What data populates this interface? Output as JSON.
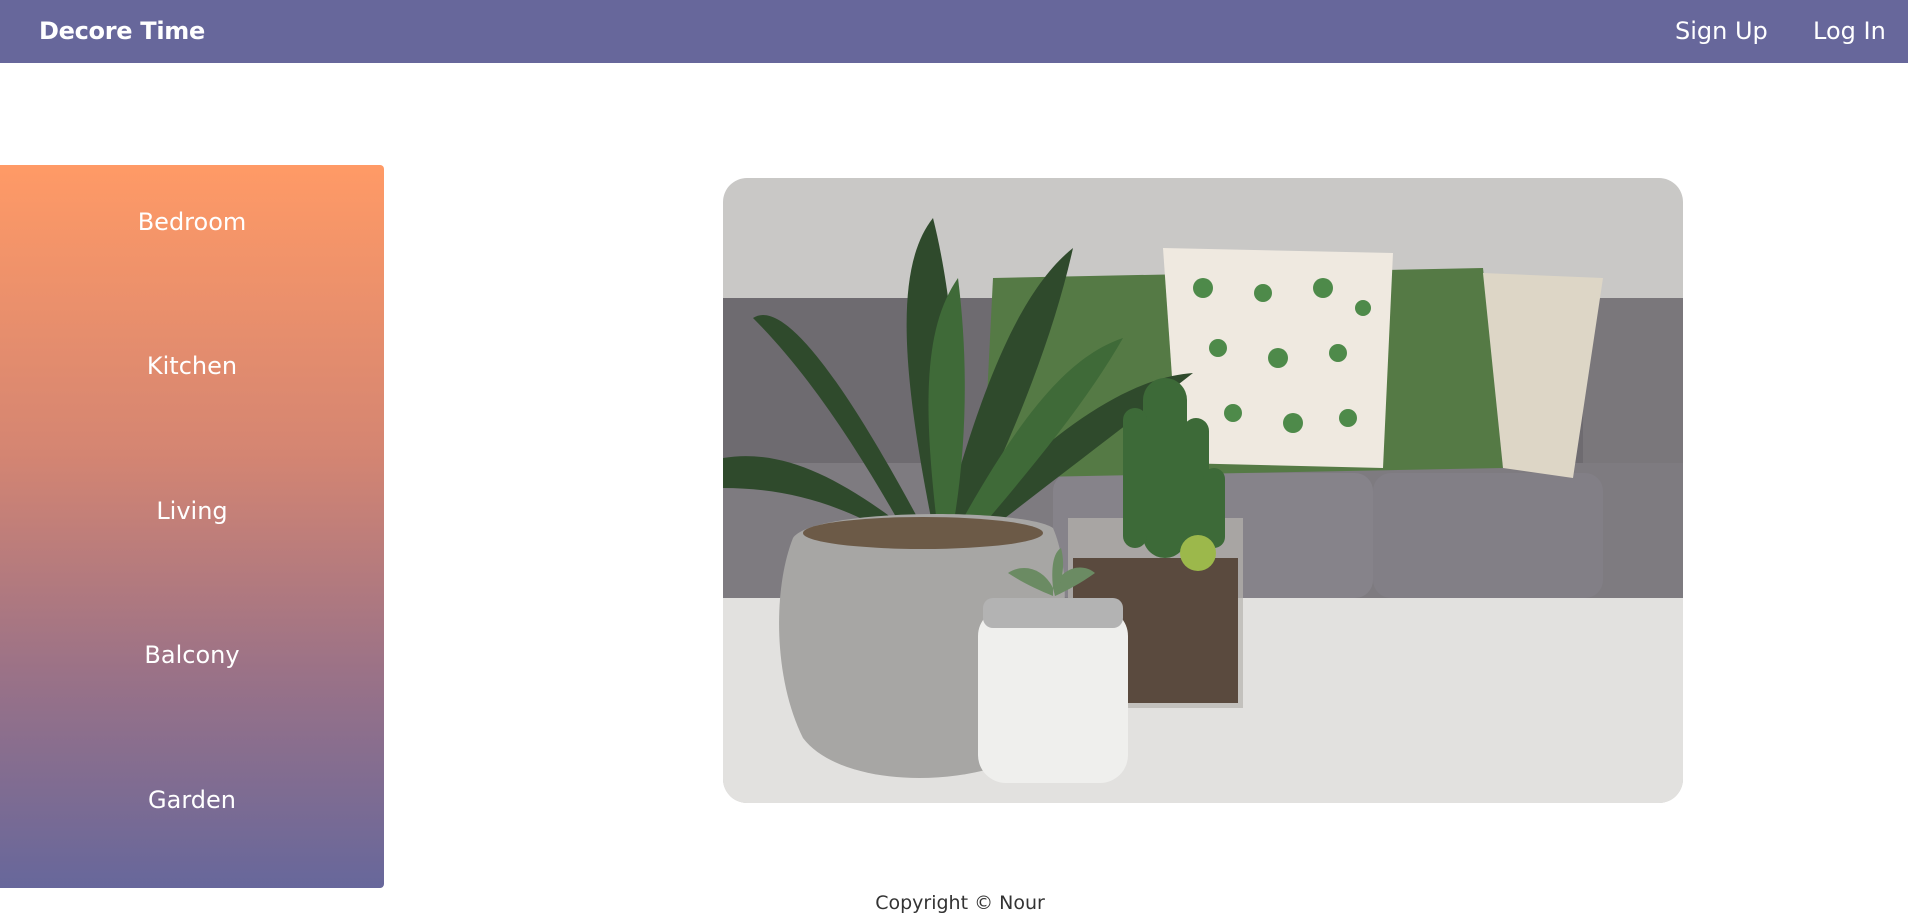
{
  "header": {
    "brand": "Decore Time",
    "nav": {
      "signup": "Sign Up",
      "login": "Log In"
    }
  },
  "sidebar": {
    "items": [
      {
        "label": "Bedroom"
      },
      {
        "label": "Kitchen"
      },
      {
        "label": "Living"
      },
      {
        "label": "Balcony"
      },
      {
        "label": "Garden"
      }
    ]
  },
  "footer": {
    "copyright": "Copyright © Nour"
  },
  "colors": {
    "navbar": "#67679b",
    "sidebar_top": "#ff9a66",
    "sidebar_bottom": "#67679b"
  }
}
